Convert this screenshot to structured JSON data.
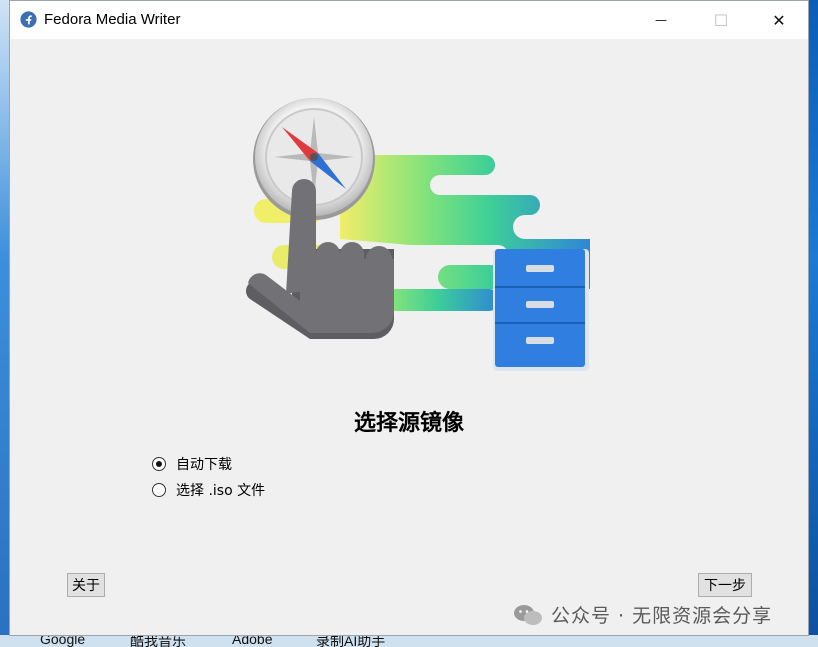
{
  "window": {
    "title": "Fedora Media Writer",
    "minimize_glyph": "—",
    "maximize_glyph": "☐",
    "close_glyph": "✕"
  },
  "main": {
    "heading": "选择源镜像",
    "options": [
      {
        "label": "自动下载",
        "checked": true
      },
      {
        "label": "选择 .iso 文件",
        "checked": false
      }
    ]
  },
  "footer": {
    "about_label": "关于",
    "next_label": "下一步"
  },
  "watermark": {
    "text": "公众号 · 无限资源会分享"
  },
  "taskbar": {
    "items": [
      "Google",
      "酷我音乐",
      "Adobe",
      "录制AI助手"
    ]
  },
  "colors": {
    "accent_blue": "#3b82d8",
    "cabinet_blue": "#2f7ee0",
    "hand_gray": "#6f6e73",
    "compass_red": "#e03a3e"
  },
  "icons": {
    "app": "fedora-icon",
    "illustration": "hand-compass-cabinet-illustration"
  }
}
